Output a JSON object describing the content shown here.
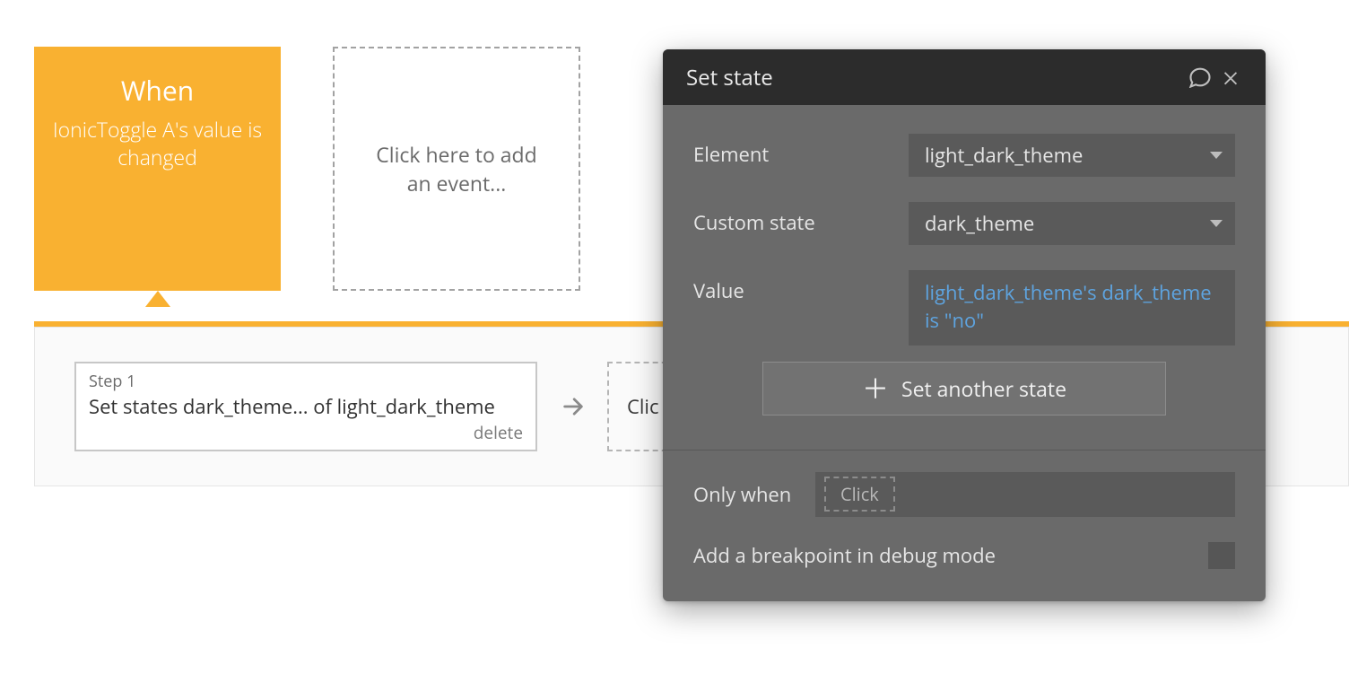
{
  "workflow": {
    "when": {
      "title": "When",
      "description": "IonicToggle A's value is changed"
    },
    "add_event_label": "Click here to add an event...",
    "step": {
      "label": "Step 1",
      "text": "Set states dark_theme... of light_dark_theme",
      "delete_label": "delete"
    },
    "add_action_label": "Clic"
  },
  "panel": {
    "title": "Set state",
    "rows": {
      "element_label": "Element",
      "element_value": "light_dark_theme",
      "custom_state_label": "Custom state",
      "custom_state_value": "dark_theme",
      "value_label": "Value",
      "value_expression": "light_dark_theme's dark_theme is \"no\""
    },
    "set_another_label": "Set another state",
    "only_when_label": "Only when",
    "only_when_placeholder": "Click",
    "breakpoint_label": "Add a breakpoint in debug mode"
  },
  "colors": {
    "accent": "#f9b131",
    "expression": "#5ea4e0"
  }
}
